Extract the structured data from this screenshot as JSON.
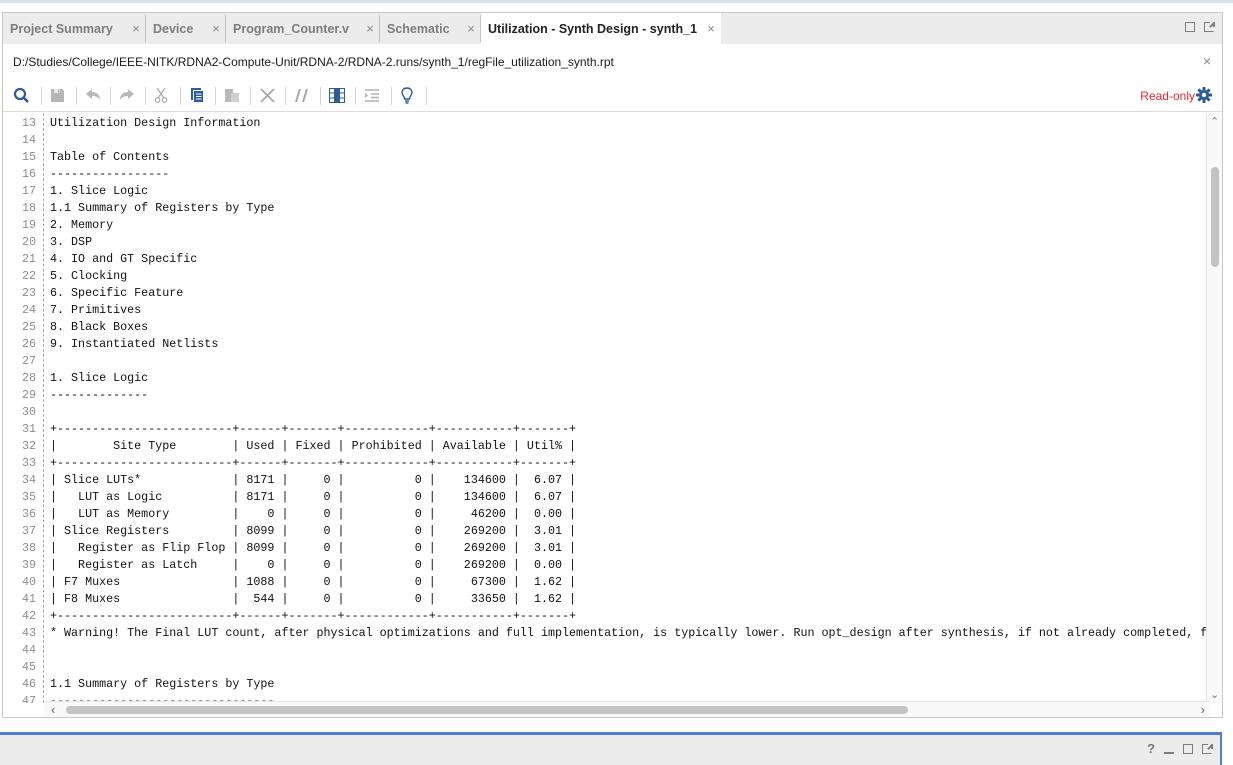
{
  "tabs": [
    {
      "label": "Project Summary",
      "active": false
    },
    {
      "label": "Device",
      "active": false
    },
    {
      "label": "Program_Counter.v",
      "active": false
    },
    {
      "label": "Schematic",
      "active": false
    },
    {
      "label": "Utilization - Synth Design - synth_1",
      "active": true
    }
  ],
  "tab_close_glyph": "×",
  "file_path": "D:/Studies/College/IEEE-NITK/RDNA2-Compute-Unit/RDNA-2/RDNA-2.runs/synth_1/regFile_utilization_synth.rpt",
  "path_close_glyph": "×",
  "toolbar": {
    "items": [
      "search-icon",
      "save-icon",
      "undo-icon",
      "redo-icon",
      "cut-icon",
      "copy-icon",
      "paste-icon",
      "delete-icon",
      "toggle-comment-icon",
      "column-select-icon",
      "indent-icon",
      "quick-help-icon"
    ],
    "status": "Read-only",
    "settings": "gear-icon"
  },
  "editor": {
    "lines": [
      {
        "n": "13",
        "t": "Utilization Design Information"
      },
      {
        "n": "14",
        "t": ""
      },
      {
        "n": "15",
        "t": "Table of Contents"
      },
      {
        "n": "16",
        "t": "-----------------"
      },
      {
        "n": "17",
        "t": "1. Slice Logic"
      },
      {
        "n": "18",
        "t": "1.1 Summary of Registers by Type"
      },
      {
        "n": "19",
        "t": "2. Memory"
      },
      {
        "n": "20",
        "t": "3. DSP"
      },
      {
        "n": "21",
        "t": "4. IO and GT Specific"
      },
      {
        "n": "22",
        "t": "5. Clocking"
      },
      {
        "n": "23",
        "t": "6. Specific Feature"
      },
      {
        "n": "24",
        "t": "7. Primitives"
      },
      {
        "n": "25",
        "t": "8. Black Boxes"
      },
      {
        "n": "26",
        "t": "9. Instantiated Netlists"
      },
      {
        "n": "27",
        "t": ""
      },
      {
        "n": "28",
        "t": "1. Slice Logic"
      },
      {
        "n": "29",
        "t": "--------------"
      },
      {
        "n": "30",
        "t": ""
      },
      {
        "n": "31",
        "t": "+-------------------------+------+-------+------------+-----------+-------+"
      },
      {
        "n": "32",
        "t": "|        Site Type        | Used | Fixed | Prohibited | Available | Util% |"
      },
      {
        "n": "33",
        "t": "+-------------------------+------+-------+------------+-----------+-------+"
      },
      {
        "n": "34",
        "t": "| Slice LUTs*             | 8171 |     0 |          0 |    134600 |  6.07 |"
      },
      {
        "n": "35",
        "t": "|   LUT as Logic          | 8171 |     0 |          0 |    134600 |  6.07 |"
      },
      {
        "n": "36",
        "t": "|   LUT as Memory         |    0 |     0 |          0 |     46200 |  0.00 |"
      },
      {
        "n": "37",
        "t": "| Slice Registers         | 8099 |     0 |          0 |    269200 |  3.01 |"
      },
      {
        "n": "38",
        "t": "|   Register as Flip Flop | 8099 |     0 |          0 |    269200 |  3.01 |"
      },
      {
        "n": "39",
        "t": "|   Register as Latch     |    0 |     0 |          0 |    269200 |  0.00 |"
      },
      {
        "n": "40",
        "t": "| F7 Muxes                | 1088 |     0 |          0 |     67300 |  1.62 |"
      },
      {
        "n": "41",
        "t": "| F8 Muxes                |  544 |     0 |          0 |     33650 |  1.62 |"
      },
      {
        "n": "42",
        "t": "+-------------------------+------+-------+------------+-----------+-------+"
      },
      {
        "n": "43",
        "t": "* Warning! The Final LUT count, after physical optimizations and full implementation, is typically lower. Run opt_design after synthesis, if not already completed, for a more realistic count."
      },
      {
        "n": "44",
        "t": ""
      },
      {
        "n": "45",
        "t": ""
      },
      {
        "n": "46",
        "t": "1.1 Summary of Registers by Type"
      },
      {
        "n": "47",
        "t": "--------------------------------"
      }
    ]
  },
  "scroll": {
    "vertical_position_fraction": 0.09,
    "horizontal_position_fraction": 0.0
  },
  "bottom_panel": {
    "help_glyph": "?"
  }
}
